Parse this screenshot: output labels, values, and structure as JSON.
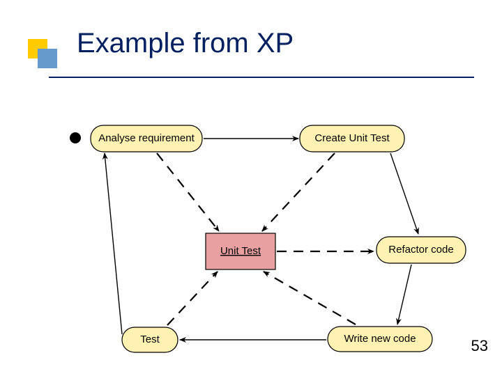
{
  "slide": {
    "title": "Example from XP",
    "page_number": "53"
  },
  "nodes": {
    "analyse": "Analyse requirement",
    "create": "Create Unit Test",
    "refactor": "Refactor code",
    "write": "Write new code",
    "test": "Test",
    "center": "Unit Test"
  }
}
